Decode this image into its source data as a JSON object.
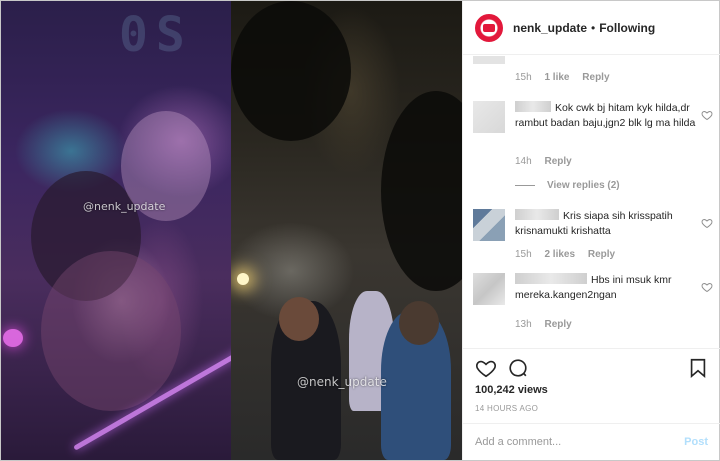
{
  "media": {
    "watermark_left": "@nenk_update",
    "watermark_right": "@nenk_update"
  },
  "header": {
    "username": "nenk_update",
    "separator": "•",
    "follow_status": "Following",
    "avatar_icon": "profile-logo"
  },
  "comments": {
    "top": {
      "time": "15h",
      "likes": "1 like",
      "reply": "Reply"
    },
    "items": [
      {
        "text": "Kok cwk bj hitam kyk hilda,dr rambut badan baju,jgn2 blk lg ma hilda",
        "time": "14h",
        "likes": "",
        "reply": "Reply",
        "view_replies": "View replies (2)"
      },
      {
        "text": "Kris siapa sih krisspatih krisnamukti krishatta",
        "time": "15h",
        "likes": "2 likes",
        "reply": "Reply"
      },
      {
        "text": "Hbs ini msuk kmr mereka.kangen2ngan",
        "time": "13h",
        "likes": "",
        "reply": "Reply"
      }
    ]
  },
  "actions": {
    "like_icon": "heart-icon",
    "comment_icon": "comment-icon",
    "save_icon": "bookmark-icon",
    "views": "100,242 views",
    "posted": "14 HOURS AGO"
  },
  "composer": {
    "placeholder": "Add a comment...",
    "post_label": "Post"
  },
  "colors": {
    "text": "#262626",
    "muted": "#999999",
    "post_disabled": "#b2dffc",
    "brand_red": "#e2183b"
  }
}
